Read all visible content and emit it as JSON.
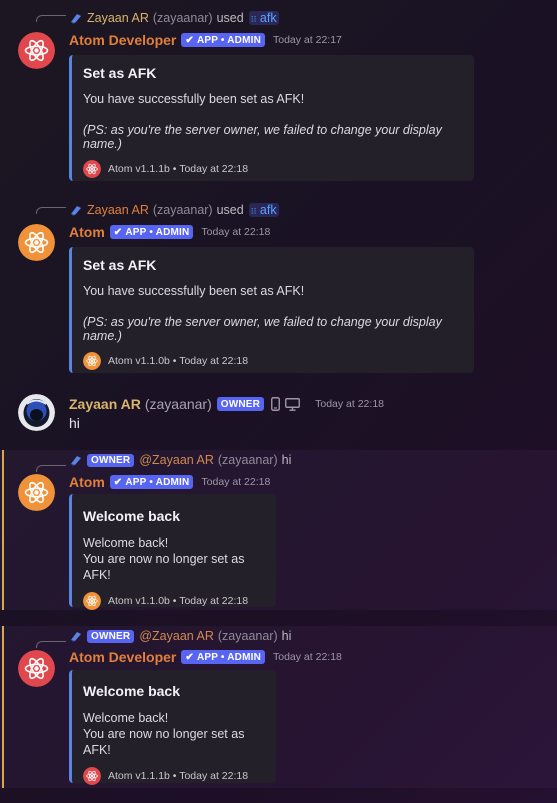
{
  "colors": {
    "accent": "#5865f2",
    "embed_border": "#5b83e0",
    "name_orange": "#e0803a",
    "name_gold": "#d9b56b",
    "atom_red": "#e0484e",
    "atom_orange": "#f0923a",
    "mention_bar": "#d7a94a"
  },
  "icons": {
    "slash_command": "slash-command-icon",
    "atom_logo": "atom-icon",
    "verified_check": "check-icon",
    "mobile": "mobile-icon",
    "desktop": "desktop-icon"
  },
  "messages": [
    {
      "reply": {
        "author": "Zayaan AR",
        "handle": "(zayaanar)",
        "used": "used",
        "command": "afk"
      },
      "author": "Atom Developer",
      "badge": "APP • ADMIN",
      "timestamp": "Today at 22:17",
      "embed": {
        "title": "Set as AFK",
        "description": "You have successfully been set as AFK!",
        "note": "(PS: as you're the server owner, we failed to change your display name.)",
        "footer": "Atom v1.1.1b • Today at 22:18"
      }
    },
    {
      "reply": {
        "author": "Zayaan AR",
        "handle": "(zayaanar)",
        "used": "used",
        "command": "afk"
      },
      "author": "Atom",
      "badge": "APP • ADMIN",
      "timestamp": "Today at 22:18",
      "embed": {
        "title": "Set as AFK",
        "description": "You have successfully been set as AFK!",
        "note": "(PS: as you're the server owner, we failed to change your display name.)",
        "footer": "Atom v1.1.0b • Today at 22:18"
      }
    },
    {
      "author": "Zayaan AR",
      "handle": "(zayaanar)",
      "badge": "OWNER",
      "timestamp": "Today at 22:18",
      "content": "hi"
    },
    {
      "reply": {
        "badge": "OWNER",
        "mention": "@Zayaan AR",
        "handle": "(zayaanar)",
        "text": "hi"
      },
      "author": "Atom",
      "badge": "APP • ADMIN",
      "timestamp": "Today at 22:18",
      "embed": {
        "title": "Welcome back",
        "line1": "Welcome back!",
        "line2": "You are now no longer set as AFK!",
        "footer": "Atom v1.1.0b • Today at 22:18"
      }
    },
    {
      "reply": {
        "badge": "OWNER",
        "mention": "@Zayaan AR",
        "handle": "(zayaanar)",
        "text": "hi"
      },
      "author": "Atom Developer",
      "badge": "APP • ADMIN",
      "timestamp": "Today at 22:18",
      "embed": {
        "title": "Welcome back",
        "line1": "Welcome back!",
        "line2": "You are now no longer set as AFK!",
        "footer": "Atom v1.1.1b • Today at 22:18"
      }
    }
  ]
}
